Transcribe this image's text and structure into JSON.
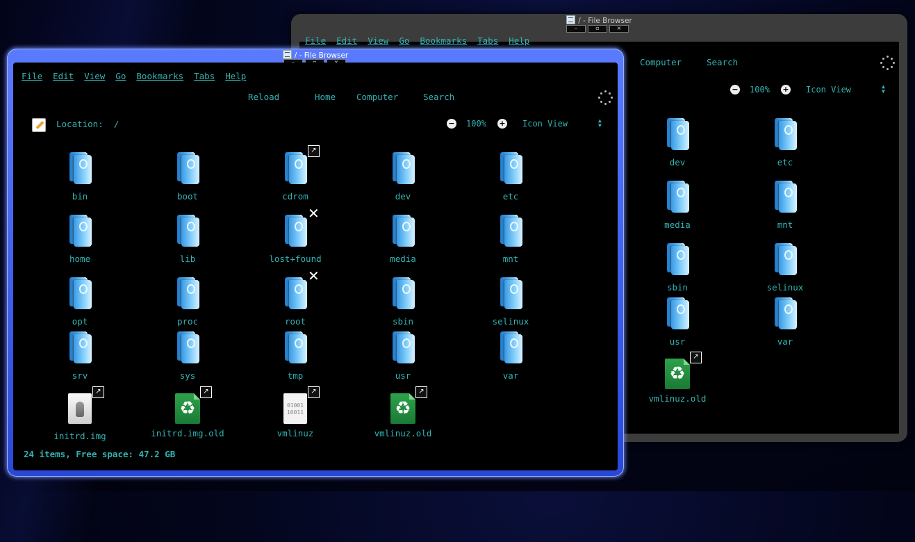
{
  "title": "/ - File Browser",
  "window_controls": [
    "–",
    "▫",
    "×"
  ],
  "menu": [
    "File",
    "Edit",
    "View",
    "Go",
    "Bookmarks",
    "Tabs",
    "Help"
  ],
  "toolbar": {
    "reload": "Reload",
    "home": "Home",
    "computer": "Computer",
    "search": "Search"
  },
  "location": {
    "label": "Location:",
    "value": "/"
  },
  "zoom": {
    "level": "100%",
    "view_mode": "Icon View"
  },
  "front_items": [
    {
      "name": "bin",
      "type": "folder"
    },
    {
      "name": "boot",
      "type": "folder"
    },
    {
      "name": "cdrom",
      "type": "folder",
      "badge": "link"
    },
    {
      "name": "dev",
      "type": "folder"
    },
    {
      "name": "etc",
      "type": "folder"
    },
    {
      "name": "home",
      "type": "folder"
    },
    {
      "name": "lib",
      "type": "folder"
    },
    {
      "name": "lost+found",
      "type": "folder",
      "badge": "noaccess"
    },
    {
      "name": "media",
      "type": "folder"
    },
    {
      "name": "mnt",
      "type": "folder"
    },
    {
      "name": "opt",
      "type": "folder"
    },
    {
      "name": "proc",
      "type": "folder"
    },
    {
      "name": "root",
      "type": "folder",
      "badge": "noaccess"
    },
    {
      "name": "sbin",
      "type": "folder"
    },
    {
      "name": "selinux",
      "type": "folder"
    },
    {
      "name": "srv",
      "type": "folder"
    },
    {
      "name": "sys",
      "type": "folder"
    },
    {
      "name": "tmp",
      "type": "folder"
    },
    {
      "name": "usr",
      "type": "folder"
    },
    {
      "name": "var",
      "type": "folder"
    },
    {
      "name": "initrd.img",
      "type": "zip",
      "badge": "link"
    },
    {
      "name": "initrd.img.old",
      "type": "recycle",
      "badge": "link"
    },
    {
      "name": "vmlinuz",
      "type": "binary",
      "badge": "link"
    },
    {
      "name": "vmlinuz.old",
      "type": "recycle",
      "badge": "link"
    }
  ],
  "back_items": [
    {
      "name": "dev",
      "type": "folder"
    },
    {
      "name": "etc",
      "type": "folder"
    },
    {
      "name": "media",
      "type": "folder"
    },
    {
      "name": "mnt",
      "type": "folder"
    },
    {
      "name": "sbin",
      "type": "folder"
    },
    {
      "name": "selinux",
      "type": "folder"
    },
    {
      "name": "usr",
      "type": "folder"
    },
    {
      "name": "var",
      "type": "folder"
    },
    {
      "name": "vmlinuz.old",
      "type": "recycle",
      "badge": "link"
    }
  ],
  "status": "24 items, Free space: 47.2 GB",
  "binary_glyph": "01001\n10011",
  "icons": {
    "link_badge": "↗",
    "noaccess_badge": "✕",
    "recycle": "♻"
  },
  "colors": {
    "text": "#33b3b3",
    "front_frame": "#3f5fe8",
    "back_frame": "#3c3c3c",
    "background": "#000000"
  }
}
